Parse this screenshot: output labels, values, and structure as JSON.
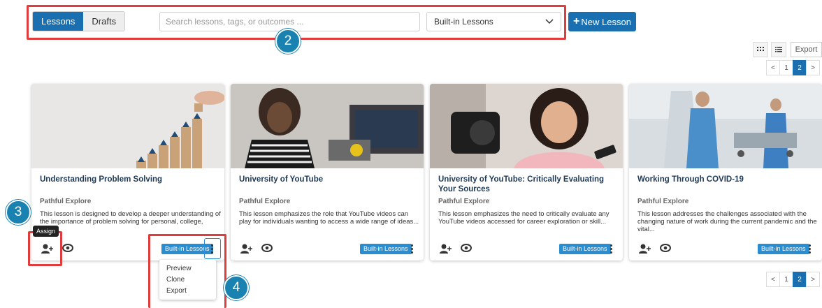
{
  "toolbar": {
    "tabs": [
      "Lessons",
      "Drafts"
    ],
    "search_placeholder": "Search lessons, tags, or outcomes ...",
    "filter_selected": "Built-in Lessons",
    "new_lesson_plus": "+",
    "new_lesson_label": "New Lesson"
  },
  "view": {
    "grid_icon": "grid-icon",
    "list_icon": "list-icon",
    "export_label": "Export"
  },
  "pagination": {
    "prev": "<",
    "pages": [
      "1",
      "2"
    ],
    "current": "2",
    "next": ">"
  },
  "cards": [
    {
      "title": "Understanding Problem Solving",
      "source": "Pathful Explore",
      "description": "This lesson is designed to develop a deeper understanding of the importance of problem solving for personal, college,",
      "tag": "Built-in Lessons"
    },
    {
      "title": "University of YouTube",
      "source": "Pathful Explore",
      "description": "This lesson emphasizes the role that YouTube videos can play for individuals wanting to access a wide range of ideas...",
      "tag": "Built-in Lessons"
    },
    {
      "title": "University of YouTube: Critically Evaluating Your Sources",
      "source": "Pathful Explore",
      "description": "This lesson emphasizes the need to critically evaluate any YouTube videos accessed for career exploration or skill...",
      "tag": "Built-in Lessons"
    },
    {
      "title": "Working Through COVID-19",
      "source": "Pathful Explore",
      "description": "This lesson addresses the challenges associated with the changing nature of work during the current pandemic and the vital...",
      "tag": "Built-in Lessons"
    }
  ],
  "tooltip": "Assign",
  "context_menu": [
    "Preview",
    "Clone",
    "Export"
  ],
  "callouts": [
    "2",
    "3",
    "4"
  ],
  "colors": {
    "primary": "#1a6fb0",
    "tag": "#2a8dd0",
    "callout": "#1a82b0",
    "highlight": "#e03c3c"
  }
}
